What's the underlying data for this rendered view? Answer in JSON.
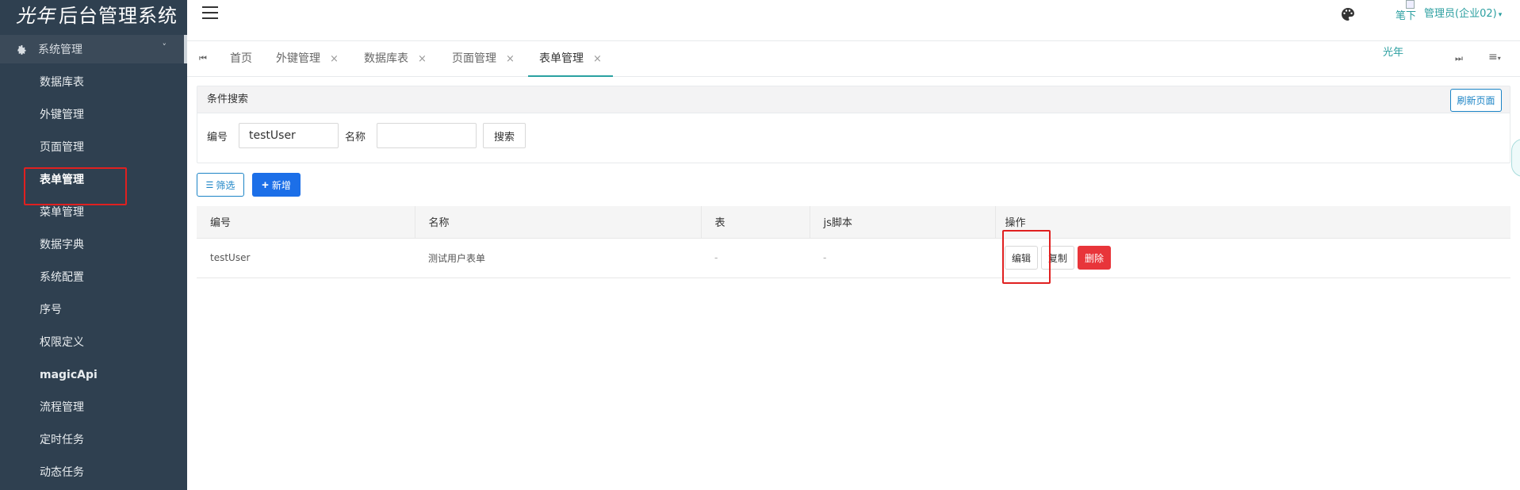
{
  "brand": {
    "logo_mark": "光年",
    "title": "后台管理系统"
  },
  "sidebar": {
    "root_label": "系统管理",
    "root_chevron": "˅",
    "items": [
      {
        "label": "数据库表"
      },
      {
        "label": "外键管理"
      },
      {
        "label": "页面管理"
      },
      {
        "label": "表单管理",
        "active": true
      },
      {
        "label": "菜单管理"
      },
      {
        "label": "数据字典"
      },
      {
        "label": "系统配置"
      },
      {
        "label": "序号"
      },
      {
        "label": "权限定义"
      },
      {
        "label": "magicApi"
      },
      {
        "label": "流程管理"
      },
      {
        "label": "定时任务"
      },
      {
        "label": "动态任务"
      }
    ]
  },
  "header": {
    "avatar_alt": "笔下",
    "user_label": "管理员(企业02)",
    "user_caret": "▾",
    "avatar_alt_2": "光年"
  },
  "tabs": {
    "items": [
      {
        "label": "首页",
        "closable": false
      },
      {
        "label": "外键管理",
        "closable": true
      },
      {
        "label": "数据库表",
        "closable": true
      },
      {
        "label": "页面管理",
        "closable": true
      },
      {
        "label": "表单管理",
        "closable": true,
        "active": true
      }
    ],
    "close_glyph": "×",
    "prev_glyph": "⏮",
    "next_glyph": "⏭",
    "menu_glyph": "≡",
    "menu_caret": "▾"
  },
  "search": {
    "title": "条件搜索",
    "refresh_label": "刷新页面",
    "code_label": "编号",
    "code_value": "testUser",
    "name_label": "名称",
    "name_value": "",
    "search_label": "搜索"
  },
  "toolbar": {
    "filter_icon": "☰",
    "filter_label": "筛选",
    "add_icon": "+",
    "add_label": "新增"
  },
  "table": {
    "columns": [
      "编号",
      "名称",
      "表",
      "js脚本",
      "操作"
    ],
    "rows": [
      {
        "code": "testUser",
        "name": "测试用户表单",
        "table": "-",
        "js": "-"
      }
    ],
    "actions": {
      "edit": "编辑",
      "copy": "复制",
      "delete": "删除"
    }
  },
  "colors": {
    "sidebar_bg": "#2f4050",
    "accent_teal": "#2aa1a1",
    "primary_blue": "#1c6fe8",
    "danger_red": "#e8353a",
    "highlight_red": "#e02020"
  },
  "icons": {
    "gear": "gear-icon",
    "hamburger": "hamburger-icon",
    "palette": "palette-icon"
  }
}
